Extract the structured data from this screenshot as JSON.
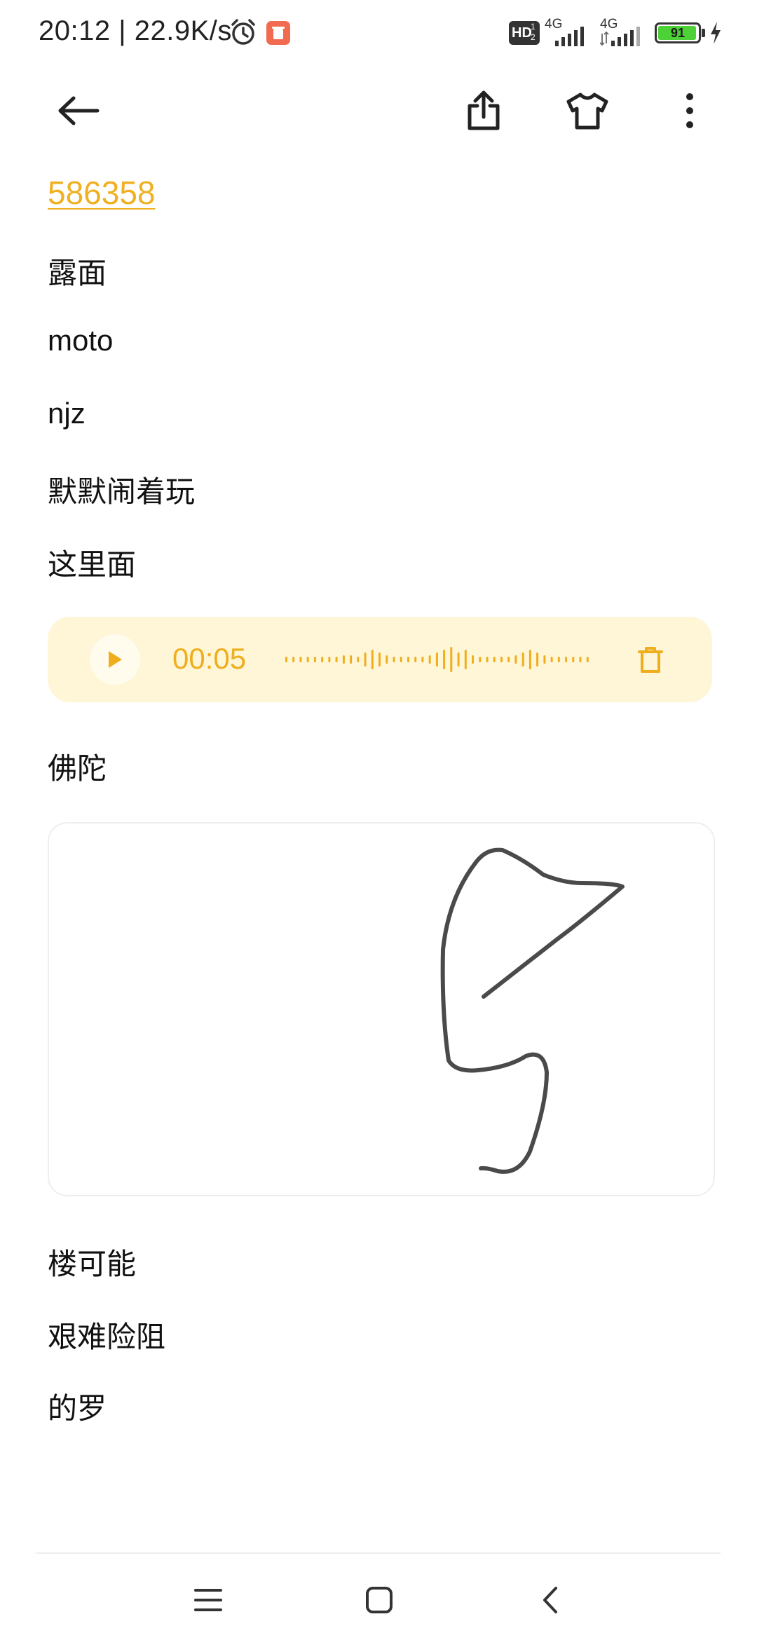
{
  "status_bar": {
    "time_and_speed": "20:12 | 22.9K/s",
    "hd_label": "HD",
    "hd_sub": "1",
    "hd_sub2": "2",
    "network_1": "4G",
    "network_2": "4G",
    "battery_level": "91"
  },
  "note": {
    "link_text": "586358",
    "lines_before_audio": [
      "露面",
      "moto",
      "njz",
      "默默闹着玩",
      "这里面"
    ],
    "audio": {
      "duration": "00:05"
    },
    "line_after_audio": "佛陀",
    "lines_after_drawing": [
      "楼可能",
      "艰难险阻",
      "的罗"
    ]
  },
  "colors": {
    "accent": "#f0b021",
    "audio_bg": "#fff6d8",
    "text": "#111111"
  },
  "icons": {
    "back": "back-arrow-icon",
    "share": "share-icon",
    "theme": "tshirt-icon",
    "more": "more-vertical-icon",
    "play": "play-icon",
    "delete": "trash-icon",
    "nav_menu": "menu-icon",
    "nav_home": "home-icon",
    "nav_back": "back-chevron-icon"
  }
}
